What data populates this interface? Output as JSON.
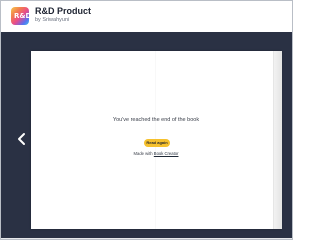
{
  "header": {
    "icon_letters": "R&D",
    "title": "R&D Product",
    "subtitle": "by Sriwahyuni"
  },
  "viewer": {
    "end_message": "You've reached the end of the book",
    "read_again_label": "Read again",
    "made_with_prefix": "Made with",
    "made_with_link": "Book Creator"
  },
  "colors": {
    "viewer_background": "#2a3144",
    "read_again_button": "#f6c12d",
    "page": "#ffffff"
  },
  "icons": {
    "prev": "chevron-left-icon"
  }
}
